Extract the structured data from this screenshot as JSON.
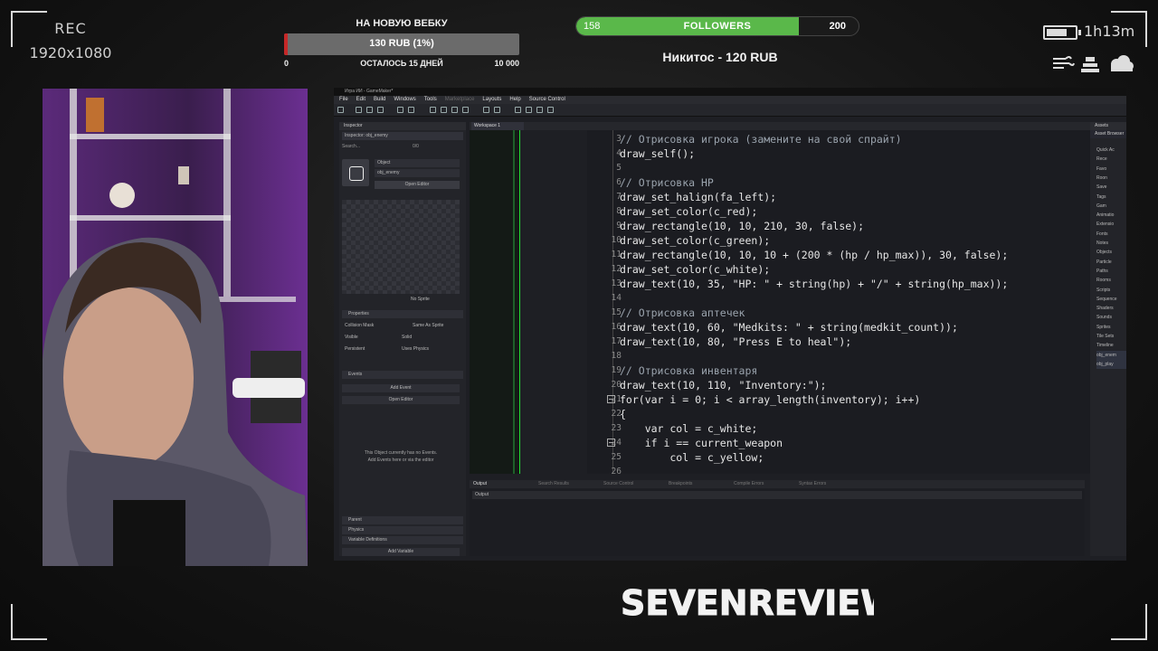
{
  "overlay": {
    "rec": "REC",
    "resolution": "1920x1080",
    "goal": {
      "title": "НА НОВУЮ ВЕБКУ",
      "amount": "130 RUB (1%)",
      "min": "0",
      "remaining": "ОСТАЛОСЬ 15 ДНЕЙ",
      "max": "10 000",
      "progress_fraction": 0.013,
      "fill_color": "#c62828"
    },
    "followers": {
      "current": "158",
      "label": "FOLLOWERS",
      "target": "200",
      "progress_fraction": 0.79,
      "fill_color": "#5ab84a"
    },
    "last_donation": "Никитос - 120 RUB",
    "timer": "1h13m",
    "battery_icon": "battery-icon",
    "weather_icons": [
      "wind-icon",
      "pressure-icon",
      "cloud-icon"
    ],
    "brand": "SEVENREVIEW"
  },
  "editor": {
    "window_title": "Игра ИИ - GameMaker*",
    "menu": [
      "File",
      "Edit",
      "Build",
      "Windows",
      "Tools",
      "Marketplace",
      "Layouts",
      "Help",
      "Source Control"
    ],
    "inspector": {
      "tab": "Inspector",
      "subtitle": "Inspector: obj_enemy",
      "search_placeholder": "Search...",
      "search_count": "0/0",
      "object_label": "Object",
      "object_name": "obj_enemy",
      "open_editor": "Open Editor",
      "sprite": "No Sprite",
      "properties": "Properties",
      "collision_mask_label": "Collision Mask",
      "collision_mask_value": "Same As Sprite",
      "visible": "Visible",
      "solid": "Solid",
      "persistent": "Persistent",
      "uses_physics": "Uses Physics",
      "events": "Events",
      "add_event": "Add Event",
      "open_editor_2": "Open Editor",
      "empty_line1": "This Object currently has no Events.",
      "empty_line2": "Add Events here or via the editor",
      "parent": "Parent",
      "physics": "Physics",
      "variable_definitions": "Variable Definitions",
      "add_variable": "Add Variable"
    },
    "workspace_tab": "Workspace 1",
    "code_lines": [
      {
        "n": "3",
        "text": "// Отрисовка игрока (замените на свой спрайт)"
      },
      {
        "n": "4",
        "text": "draw_self();"
      },
      {
        "n": "5",
        "text": ""
      },
      {
        "n": "6",
        "text": "// Отрисовка HP"
      },
      {
        "n": "7",
        "text": "draw_set_halign(fa_left);"
      },
      {
        "n": "8",
        "text": "draw_set_color(c_red);"
      },
      {
        "n": "9",
        "text": "draw_rectangle(10, 10, 210, 30, false);"
      },
      {
        "n": "10",
        "text": "draw_set_color(c_green);"
      },
      {
        "n": "11",
        "text": "draw_rectangle(10, 10, 10 + (200 * (hp / hp_max)), 30, false);"
      },
      {
        "n": "12",
        "text": "draw_set_color(c_white);"
      },
      {
        "n": "13",
        "text": "draw_text(10, 35, \"HP: \" + string(hp) + \"/\" + string(hp_max));"
      },
      {
        "n": "14",
        "text": ""
      },
      {
        "n": "15",
        "text": "// Отрисовка аптечек"
      },
      {
        "n": "16",
        "text": "draw_text(10, 60, \"Medkits: \" + string(medkit_count));"
      },
      {
        "n": "17",
        "text": "draw_text(10, 80, \"Press E to heal\");"
      },
      {
        "n": "18",
        "text": ""
      },
      {
        "n": "19",
        "text": "// Отрисовка инвентаря"
      },
      {
        "n": "20",
        "text": "draw_text(10, 110, \"Inventory:\");"
      },
      {
        "n": "21",
        "text": "for(var i = 0; i < array_length(inventory); i++)"
      },
      {
        "n": "22",
        "text": "{"
      },
      {
        "n": "23",
        "text": "    var col = c_white;"
      },
      {
        "n": "24",
        "text": "    if i == current_weapon"
      },
      {
        "n": "25",
        "text": "        col = c_yellow;"
      },
      {
        "n": "26",
        "text": ""
      }
    ],
    "asset_browser": {
      "tab": "Assets",
      "title": "Asset Browser",
      "items": [
        "Quick Ac",
        "Rece",
        "Favo",
        "Roon",
        "Save",
        "Tags",
        "Gam",
        "Animatio",
        "Extensio",
        "Fonts",
        "Notes",
        "Objects",
        "Particle",
        "Paths",
        "Rooms",
        "Scripts",
        "Sequence",
        "Shaders",
        "Sounds",
        "Sprites",
        "Tile Sets",
        "Timeline",
        "obj_enem",
        "obj_play"
      ]
    },
    "output_tabs": [
      "Output",
      "Search Results",
      "Source Control",
      "Breakpoints",
      "Compile Errors",
      "Syntax Errors"
    ],
    "output_field": "Output"
  }
}
